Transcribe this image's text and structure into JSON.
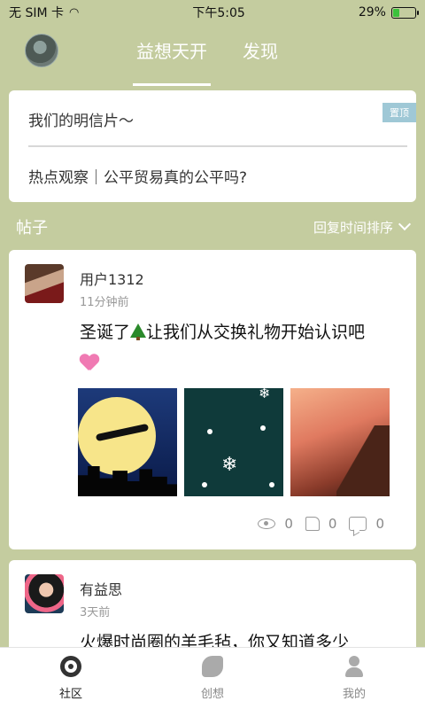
{
  "status_bar": {
    "carrier": "无 SIM 卡",
    "time": "下午5:05",
    "battery": "29%",
    "battery_level": 0.29
  },
  "top_nav": {
    "tabs": [
      {
        "label": "益想天开",
        "active": true
      },
      {
        "label": "发现",
        "active": false
      }
    ]
  },
  "notice_card": {
    "line1": "我们的明信片～",
    "line2": "热点观察｜公平贸易真的公平吗?",
    "pin_label": "置顶"
  },
  "section": {
    "title": "帖子",
    "sort_label": "回复时间排序"
  },
  "posts": [
    {
      "user": "用户1312",
      "time": "11分钟前",
      "content_a": "圣诞了",
      "content_b": "让我们从交换礼物开始认识吧",
      "views": "0",
      "likes": "0",
      "comments": "0"
    },
    {
      "user": "有益思",
      "time": "3天前",
      "content_a": "火爆时尚圈的羊毛毡，你又知道多少"
    }
  ],
  "bottom_nav": [
    {
      "label": "社区",
      "icon": "community-icon",
      "active": true
    },
    {
      "label": "创想",
      "icon": "create-icon",
      "active": false
    },
    {
      "label": "我的",
      "icon": "profile-icon",
      "active": false
    }
  ]
}
